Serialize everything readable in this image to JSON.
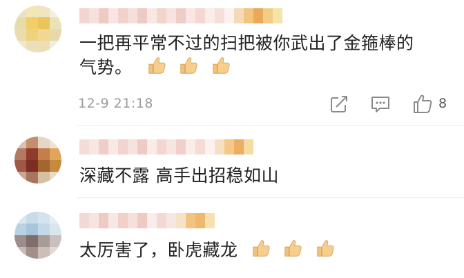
{
  "comments": [
    {
      "text_line1": "一把再平常不过的扫把被你武出了金箍棒的",
      "text_line2": "气势。",
      "emoji": [
        "thumbs-up",
        "thumbs-up",
        "thumbs-up"
      ],
      "timestamp": "12-9 21:18",
      "likes": "8"
    },
    {
      "text_line1": "深藏不露 高手出招稳如山",
      "emoji": []
    },
    {
      "text_line1": "太厉害了，卧虎藏龙",
      "emoji": [
        "thumbs-up",
        "thumbs-up",
        "thumbs-up"
      ]
    }
  ],
  "colors": {
    "text": "#222222",
    "meta": "#9a9a9a",
    "divider": "#ececec",
    "thumb_fill": "#f2c27b",
    "thumb_stroke": "#d9a25c"
  },
  "icons": [
    "share-icon",
    "comment-icon",
    "like-icon",
    "thumbs-up-emoji"
  ]
}
